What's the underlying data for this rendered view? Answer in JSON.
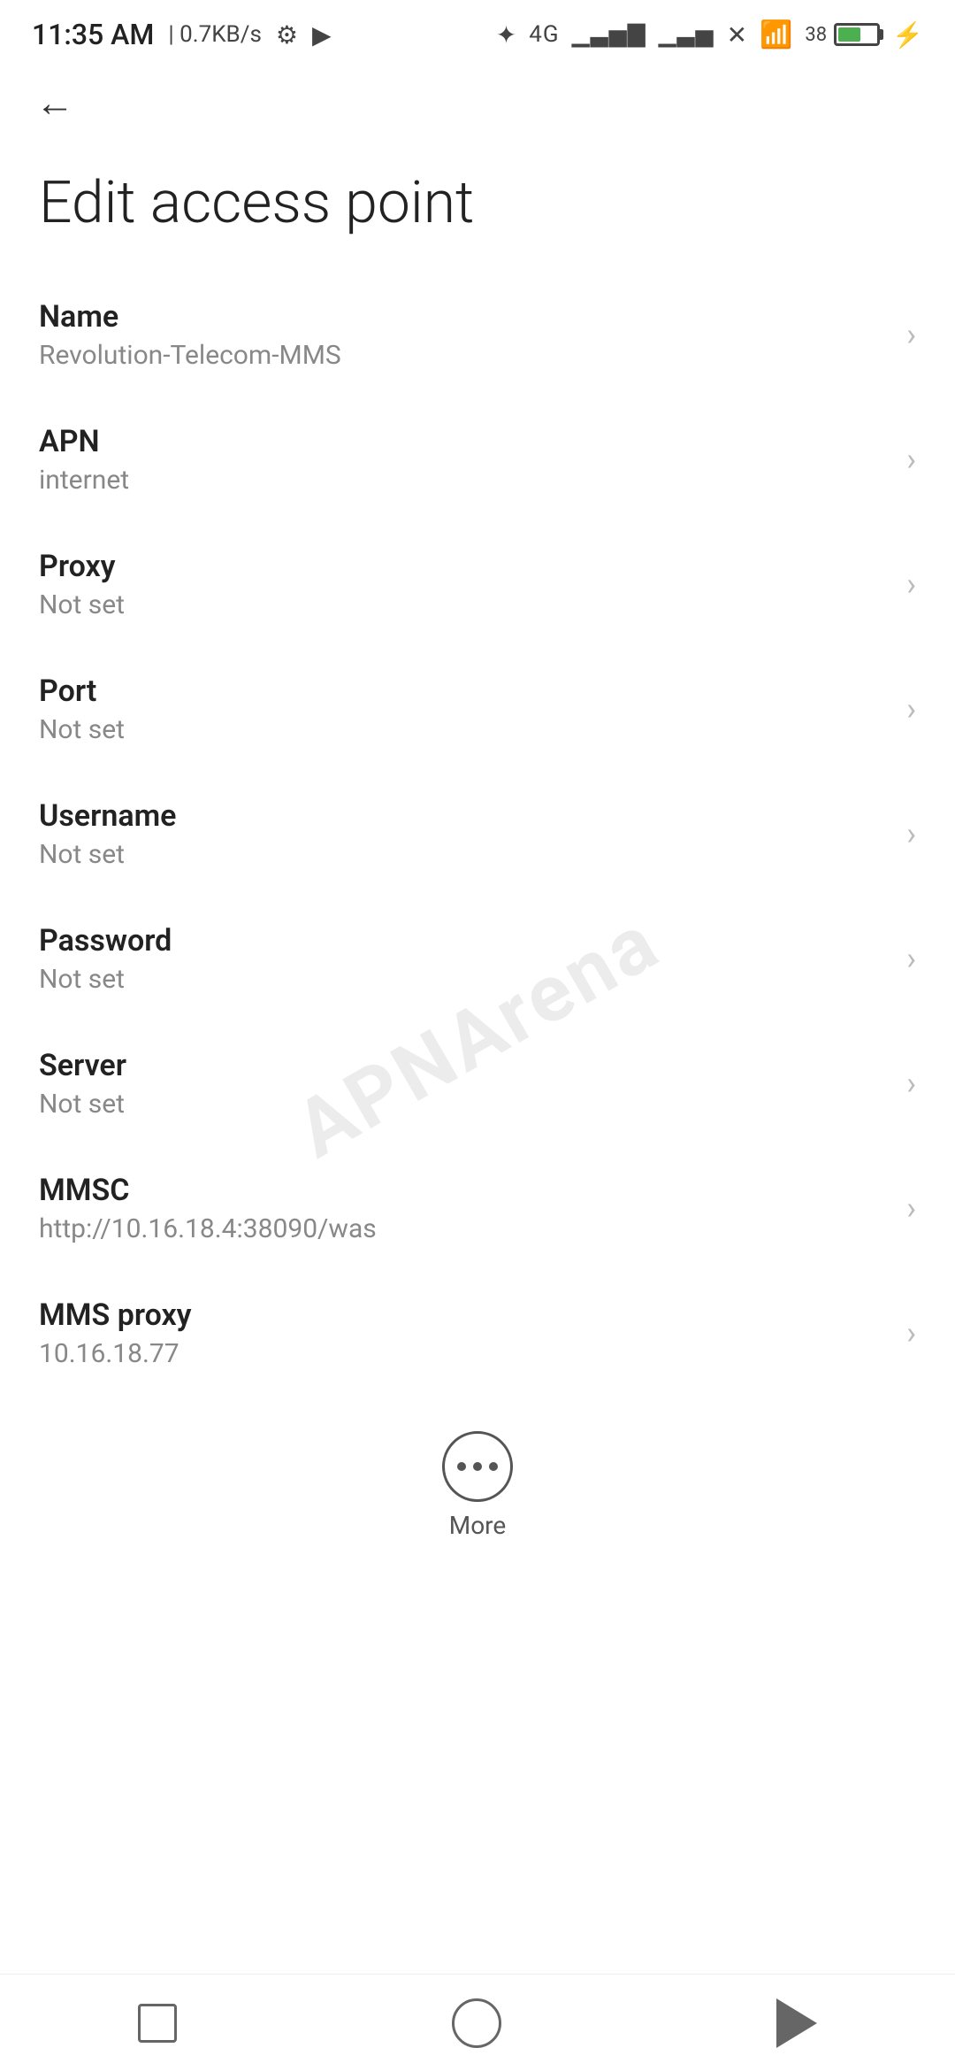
{
  "statusBar": {
    "time": "11:35 AM",
    "dataSpeed": "0.7KB/s",
    "battery": "38"
  },
  "header": {
    "backLabel": "←"
  },
  "pageTitle": "Edit access point",
  "settings": [
    {
      "id": "name",
      "label": "Name",
      "value": "Revolution-Telecom-MMS"
    },
    {
      "id": "apn",
      "label": "APN",
      "value": "internet"
    },
    {
      "id": "proxy",
      "label": "Proxy",
      "value": "Not set"
    },
    {
      "id": "port",
      "label": "Port",
      "value": "Not set"
    },
    {
      "id": "username",
      "label": "Username",
      "value": "Not set"
    },
    {
      "id": "password",
      "label": "Password",
      "value": "Not set"
    },
    {
      "id": "server",
      "label": "Server",
      "value": "Not set"
    },
    {
      "id": "mmsc",
      "label": "MMSC",
      "value": "http://10.16.18.4:38090/was"
    },
    {
      "id": "mms-proxy",
      "label": "MMS proxy",
      "value": "10.16.18.77"
    }
  ],
  "more": {
    "label": "More"
  },
  "watermark": "APNArena"
}
